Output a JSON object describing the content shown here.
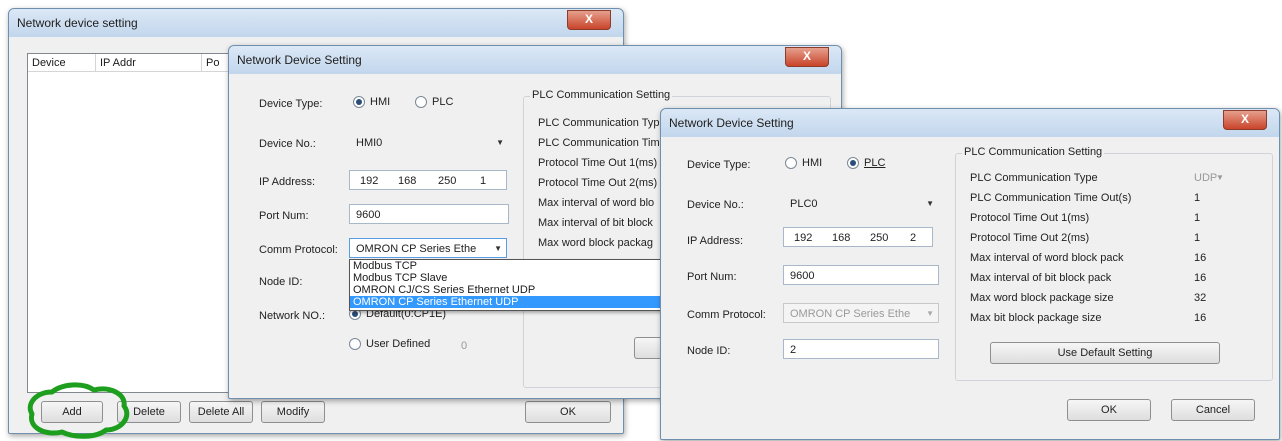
{
  "win1": {
    "title": "Network device setting",
    "close": "X",
    "columns": [
      "Device",
      "IP Addr",
      "Po"
    ],
    "buttons": {
      "add": "Add",
      "delete": "Delete",
      "delete_all": "Delete All",
      "modify": "Modify",
      "ok": "OK"
    }
  },
  "win2": {
    "title": "Network Device Setting",
    "close": "X",
    "device_type_label": "Device Type:",
    "hmi": "HMI",
    "plc": "PLC",
    "device_no_label": "Device No.:",
    "device_no": "HMI0",
    "ip_label": "IP Address:",
    "ip": [
      "192",
      "168",
      "250",
      "1"
    ],
    "port_label": "Port Num:",
    "port": "9600",
    "comm_label": "Comm Protocol:",
    "comm": "OMRON CP Series Ethe",
    "node_label": "Node ID:",
    "network_label": "Network NO.:",
    "network_default": "Default(0:CP1E)",
    "user_defined": "User Defined",
    "user_value": "0",
    "plc_group": "PLC Communication Setting",
    "plc_rows": [
      "PLC Communication Typ",
      "PLC Communication Tim",
      "Protocol Time Out 1(ms)",
      "Protocol Time Out 2(ms)",
      "Max interval of word blo",
      "Max interval of bit block",
      "Max word block packag"
    ],
    "dropdown_options": [
      "Modbus TCP",
      "Modbus TCP Slave",
      "OMRON CJ/CS Series Ethernet UDP",
      "OMRON CP Series Ethernet UDP"
    ],
    "dropdown_selected_index": 3
  },
  "win3": {
    "title": "Network Device Setting",
    "close": "X",
    "device_type_label": "Device Type:",
    "hmi": "HMI",
    "plc": "PLC",
    "device_no_label": "Device No.:",
    "device_no": "PLC0",
    "ip_label": "IP Address:",
    "ip": [
      "192",
      "168",
      "250",
      "2"
    ],
    "port_label": "Port Num:",
    "port": "9600",
    "comm_label": "Comm Protocol:",
    "comm": "OMRON CP Series Ethe",
    "node_label": "Node ID:",
    "node": "2",
    "plc_group": "PLC Communication Setting",
    "plc_rows": [
      {
        "label": "PLC Communication Type",
        "value": "UDP"
      },
      {
        "label": "PLC Communication Time Out(s)",
        "value": "1"
      },
      {
        "label": "Protocol Time Out 1(ms)",
        "value": "1"
      },
      {
        "label": "Protocol Time Out 2(ms)",
        "value": "1"
      },
      {
        "label": "Max interval of word block pack",
        "value": "16"
      },
      {
        "label": "Max interval of bit block pack",
        "value": "16"
      },
      {
        "label": "Max word block package size",
        "value": "32"
      },
      {
        "label": "Max bit block package size",
        "value": "16"
      }
    ],
    "default_button": "Use Default Setting",
    "ok": "OK",
    "cancel": "Cancel"
  },
  "colors": {
    "highlight_circle": "#1e9e1e",
    "selection": "#3399ff"
  }
}
